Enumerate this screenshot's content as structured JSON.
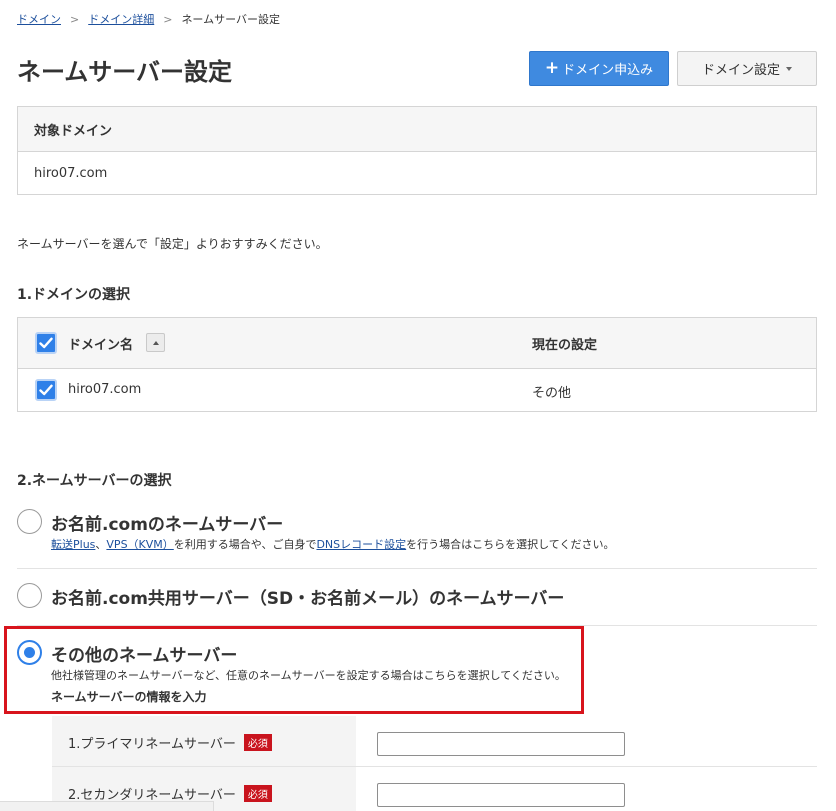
{
  "breadcrumb": {
    "items": [
      "ドメイン",
      "ドメイン詳細"
    ],
    "current": "ネームサーバー設定",
    "separator": ">"
  },
  "page": {
    "title": "ネームサーバー設定"
  },
  "buttons": {
    "apply_plus": "+",
    "apply_label": "ドメイン申込み",
    "settings_label": "ドメイン設定"
  },
  "target_domain": {
    "header": "対象ドメイン",
    "value": "hiro07.com"
  },
  "instruction": "ネームサーバーを選んで「設定」よりおすすみください。",
  "section1": {
    "title": "1.ドメインの選択",
    "table": {
      "col_name": "ドメイン名",
      "col_current": "現在の設定",
      "rows": [
        {
          "name": "hiro07.com",
          "current": "その他",
          "checked": true
        }
      ]
    }
  },
  "section2": {
    "title": "2.ネームサーバーの選択",
    "options": [
      {
        "title": "お名前.comのネームサーバー",
        "desc_parts": [
          "転送Plus",
          "、",
          "VPS（KVM）",
          "を利用する場合や、ご自身で",
          "DNSレコード設定",
          "を行う場合はこちらを選択してください。"
        ],
        "checked": false
      },
      {
        "title": "お名前.com共用サーバー（SD・お名前メール）のネームサーバー",
        "checked": false
      },
      {
        "title": "その他のネームサーバー",
        "desc": "他社様管理のネームサーバーなど、任意のネームサーバーを設定する場合はこちらを選択してください。",
        "sub_label": "ネームサーバーの情報を入力",
        "checked": true
      }
    ],
    "ns_fields": [
      {
        "label": "1.プライマリネームサーバー",
        "required": "必須",
        "value": ""
      },
      {
        "label": "2.セカンダリネームサーバー",
        "required": "必須",
        "value": ""
      }
    ]
  },
  "colors": {
    "primary_button": "#3f8ae0",
    "checkbox": "#2f80e8",
    "required_badge": "#c9141e",
    "highlight_frame": "#d8141c",
    "link": "#1c4f9c"
  }
}
